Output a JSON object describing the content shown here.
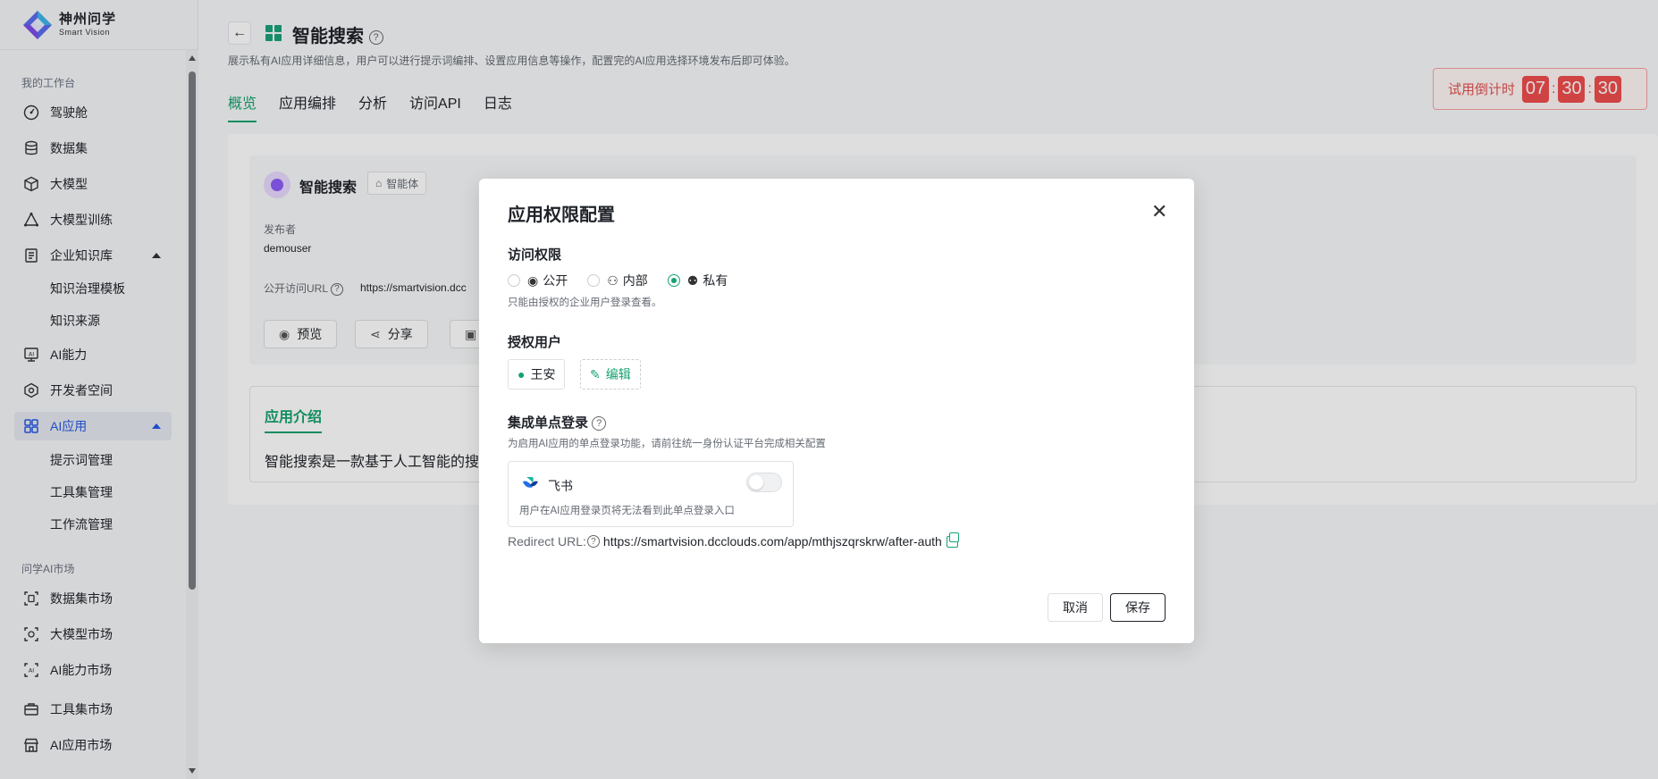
{
  "brand": {
    "name_cn": "神州问学",
    "name_en": "Smart Vision"
  },
  "sidebar": {
    "section_workspace": "我的工作台",
    "items": [
      {
        "label": "驾驶舱",
        "icon": "gauge-icon"
      },
      {
        "label": "数据集",
        "icon": "database-icon"
      },
      {
        "label": "大模型",
        "icon": "cube-icon"
      },
      {
        "label": "大模型训练",
        "icon": "training-icon"
      },
      {
        "label": "企业知识库",
        "icon": "knowledge-icon"
      },
      {
        "label": "AI能力",
        "icon": "ai-ability-icon"
      },
      {
        "label": "开发者空间",
        "icon": "developer-icon"
      },
      {
        "label": "AI应用",
        "icon": "grid-icon"
      }
    ],
    "knowledge_sub": [
      "知识治理模板",
      "知识来源"
    ],
    "app_sub": [
      "提示词管理",
      "工具集管理",
      "工作流管理"
    ],
    "section_market": "问学AI市场",
    "market_items": [
      {
        "label": "数据集市场",
        "icon": "dataset-market-icon"
      },
      {
        "label": "大模型市场",
        "icon": "model-market-icon"
      },
      {
        "label": "AI能力市场",
        "icon": "ai-market-icon"
      },
      {
        "label": "工具集市场",
        "icon": "toolbox-icon"
      },
      {
        "label": "AI应用市场",
        "icon": "store-icon"
      }
    ]
  },
  "header": {
    "title": "智能搜索",
    "description": "展示私有AI应用详细信息，用户可以进行提示词编排、设置应用信息等操作，配置完的AI应用选择环境发布后即可体验。",
    "tabs": [
      "概览",
      "应用编排",
      "分析",
      "访问API",
      "日志"
    ],
    "active_tab": "概览"
  },
  "countdown": {
    "label": "试用倒计时",
    "hours": "07",
    "minutes": "30",
    "seconds": "30"
  },
  "app_info": {
    "name": "智能搜索",
    "tag": "智能体",
    "publisher_label": "发布者",
    "publisher": "demouser",
    "url_label": "公开访问URL",
    "url": "https://smartvision.dcc",
    "buttons": [
      "预览",
      "分享"
    ],
    "intro_title": "应用介绍",
    "intro_text": "智能搜索是一款基于人工智能的搜"
  },
  "modal": {
    "title": "应用权限配置",
    "access_title": "访问权限",
    "access_options": [
      "公开",
      "内部",
      "私有"
    ],
    "access_selected": "私有",
    "access_hint": "只能由授权的企业用户登录查看。",
    "auth_title": "授权用户",
    "auth_user": "王安",
    "edit_label": "编辑",
    "sso_title": "集成单点登录",
    "sso_hint": "为启用AI应用的单点登录功能，请前往统一身份认证平台完成相关配置",
    "sso_provider": "飞书",
    "sso_enabled": false,
    "sso_desc": "用户在AI应用登录页将无法看到此单点登录入口",
    "redirect_label": "Redirect URL:",
    "redirect_url": "https://smartvision.dcclouds.com/app/mthjszqrskrw/after-auth",
    "cancel_label": "取消",
    "save_label": "保存"
  },
  "colors": {
    "accent": "#15a36f",
    "active_nav": "#2458e6",
    "countdown": "#ee4d4d"
  }
}
